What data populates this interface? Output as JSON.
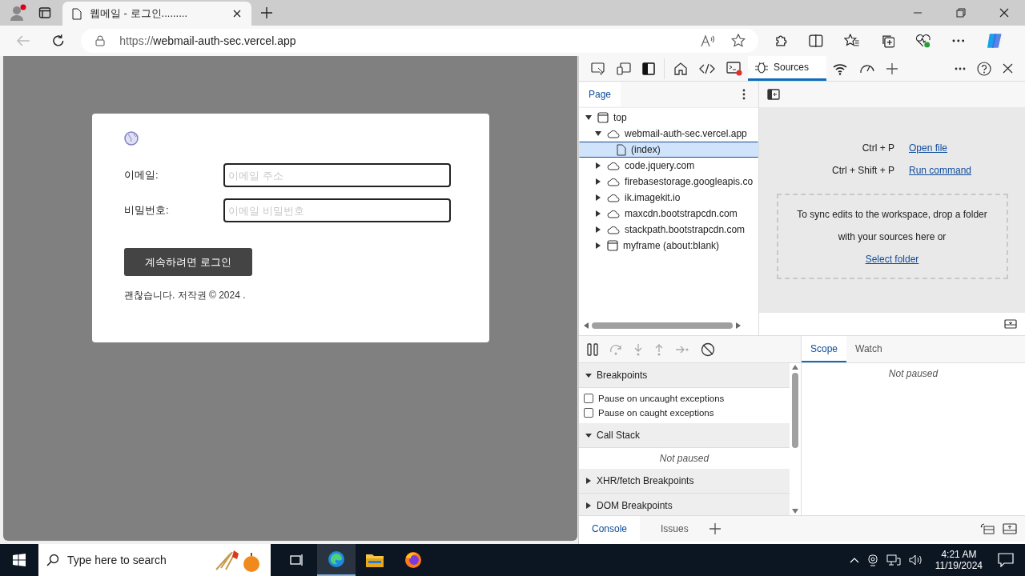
{
  "browser": {
    "tab_title": "웹메일 - 로그인.........",
    "url_scheme": "https://",
    "url_host": "webmail-auth-sec.vercel.app"
  },
  "page": {
    "fields": [
      {
        "label": "이메일:",
        "placeholder": "이메일 주소"
      },
      {
        "label": "비밀번호:",
        "placeholder": "이메일 비밀번호"
      }
    ],
    "button": "계속하려면 로그인",
    "footer": "괜찮습니다. 저작권 © 2024 ."
  },
  "devtools": {
    "tabs": [
      {
        "label": "Sources",
        "selected": true
      }
    ],
    "navigator": {
      "tabs": [
        {
          "label": "Page",
          "selected": true
        }
      ],
      "tree": [
        {
          "label": "top",
          "kind": "frame",
          "expanded": true,
          "selected": false,
          "children": [
            {
              "label": "webmail-auth-sec.vercel.app",
              "kind": "domain",
              "expanded": true,
              "selected": false,
              "children": [
                {
                  "label": "(index)",
                  "kind": "file",
                  "selected": true
                }
              ]
            },
            {
              "label": "code.jquery.com",
              "kind": "domain",
              "expanded": false,
              "selected": false
            },
            {
              "label": "firebasestorage.googleapis.co",
              "kind": "domain",
              "expanded": false,
              "selected": false
            },
            {
              "label": "ik.imagekit.io",
              "kind": "domain",
              "expanded": false,
              "selected": false
            },
            {
              "label": "maxcdn.bootstrapcdn.com",
              "kind": "domain",
              "expanded": false,
              "selected": false
            },
            {
              "label": "stackpath.bootstrapcdn.com",
              "kind": "domain",
              "expanded": false,
              "selected": false
            },
            {
              "label": "myframe (about:blank)",
              "kind": "frame",
              "expanded": false,
              "selected": false
            }
          ]
        }
      ]
    },
    "shortcuts": [
      {
        "keys": "Ctrl + P",
        "action": "Open file"
      },
      {
        "keys": "Ctrl + Shift + P",
        "action": "Run command"
      }
    ],
    "drop_zone": {
      "text": "To sync edits to the workspace, drop a folder with your sources here or",
      "link": "Select folder"
    },
    "sections": [
      {
        "title": "Breakpoints",
        "expanded": true,
        "kind": "checkboxes",
        "options": [
          {
            "label": "Pause on uncaught exceptions",
            "checked": false
          },
          {
            "label": "Pause on caught exceptions",
            "checked": false
          }
        ]
      },
      {
        "title": "Call Stack",
        "expanded": true,
        "kind": "message",
        "message": "Not paused"
      },
      {
        "title": "XHR/fetch Breakpoints",
        "expanded": false
      },
      {
        "title": "DOM Breakpoints",
        "expanded": false
      }
    ],
    "side_tabs": [
      {
        "label": "Scope",
        "selected": true
      },
      {
        "label": "Watch",
        "selected": false
      }
    ],
    "side_message": "Not paused",
    "drawer_tabs": [
      {
        "label": "Console",
        "selected": true
      },
      {
        "label": "Issues",
        "selected": false
      }
    ]
  },
  "taskbar": {
    "search_placeholder": "Type here to search",
    "time": "4:21 AM",
    "date": "11/19/2024"
  }
}
